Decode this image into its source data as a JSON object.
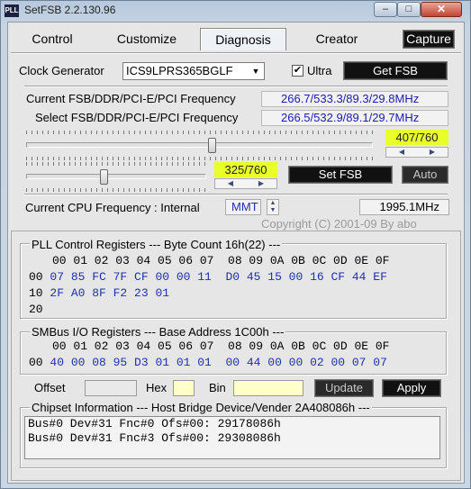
{
  "window": {
    "title": "SetFSB 2.2.130.96",
    "icon_text": "PLL",
    "min_glyph": "–",
    "max_glyph": "□",
    "close_glyph": "✕"
  },
  "tabs": [
    {
      "label": "Control"
    },
    {
      "label": "Customize"
    },
    {
      "label": "Diagnosis",
      "active": true
    },
    {
      "label": "Creator"
    }
  ],
  "capture_label": "Capture",
  "clock_generator": {
    "label": "Clock Generator",
    "value": "ICS9LPRS365BGLF",
    "arrow": "▼"
  },
  "ultra": {
    "label": "Ultra",
    "checked": true,
    "check_glyph": "✔"
  },
  "get_fsb_label": "Get FSB",
  "current_freq": {
    "label": "Current FSB/DDR/PCI-E/PCI Frequency",
    "value": "266.7/533.3/89.3/29.8MHz"
  },
  "select_freq": {
    "label": "Select FSB/DDR/PCI-E/PCI Frequency",
    "value": "266.5/532.9/89.1/29.7MHz"
  },
  "slider1": {
    "value": "407/760",
    "position": 407,
    "max": 760
  },
  "slider2": {
    "value": "325/760",
    "position": 325,
    "max": 760
  },
  "set_fsb_label": "Set FSB",
  "auto_label": "Auto",
  "spin": {
    "left": "◀",
    "right": "▶",
    "up": "▲",
    "down": "▼"
  },
  "cpu": {
    "label": "Current CPU Frequency : Internal",
    "mode": "MMT",
    "value": "1995.1MHz"
  },
  "copyright": "Copyright (C) 2001-09 By abo",
  "pll": {
    "header": "PLL Control Registers  --- Byte Count 16h(22) ---",
    "columns": "00 01 02 03 04 05 06 07  08 09 0A 0B 0C 0D 0E 0F",
    "rows": [
      {
        "addr": "00",
        "vals": "07 85 FC 7F CF 00 00 11  D0 45 15 00 16 CF 44 EF"
      },
      {
        "addr": "10",
        "vals": "2F A0 8F F2 23 01"
      },
      {
        "addr": "20",
        "vals": ""
      }
    ]
  },
  "smbus": {
    "header": "SMBus I/O Registers  --- Base Address 1C00h ---",
    "columns": "00 01 02 03 04 05 06 07  08 09 0A 0B 0C 0D 0E 0F",
    "rows": [
      {
        "addr": "00",
        "vals": "40 00 08 95 D3 01 01 01  00 44 00 00 02 00 07 07"
      }
    ]
  },
  "offset": {
    "label": "Offset",
    "value": ""
  },
  "hex": {
    "label": "Hex",
    "value": ""
  },
  "bin": {
    "label": "Bin",
    "value": ""
  },
  "update_label": "Update",
  "apply_label": "Apply",
  "chipset": {
    "header": "Chipset Information  --- Host Bridge Device/Vender 2A408086h ---",
    "lines": [
      "Bus#0 Dev#31 Fnc#0 Ofs#00: 29178086h",
      "Bus#0 Dev#31 Fnc#3 Ofs#00: 29308086h"
    ]
  },
  "colors": {
    "value_blue": "#1f2fb0",
    "highlight_green": "#e8ff2a",
    "input_yellow": "#ffffcc",
    "dark_button": "#111111"
  }
}
